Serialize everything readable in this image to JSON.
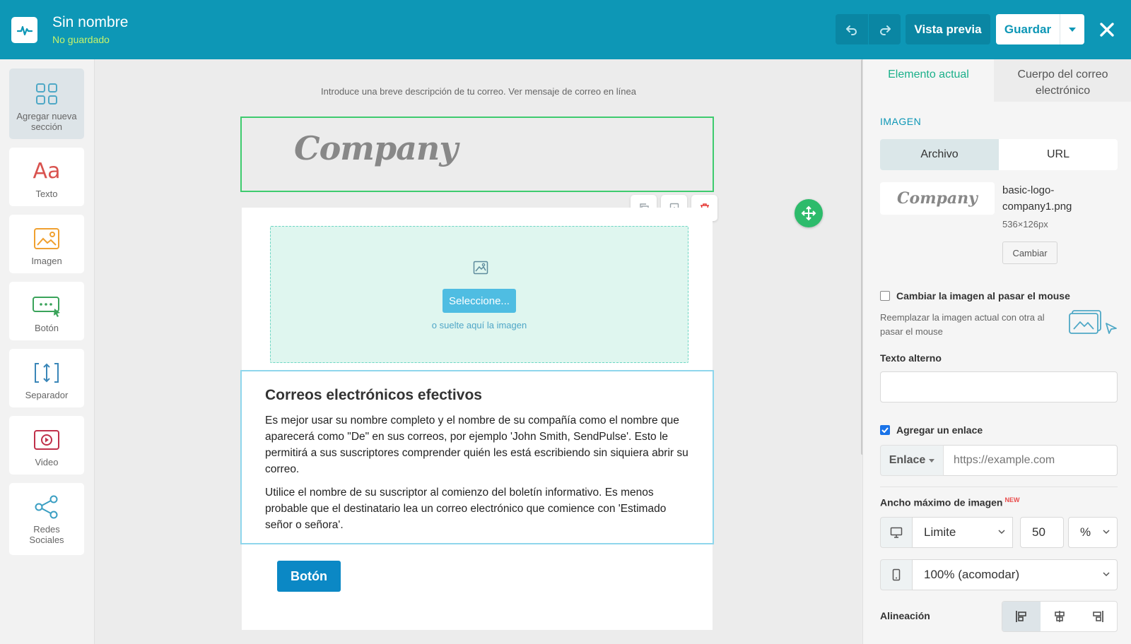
{
  "app": {
    "title": "Sin nombre",
    "status": "No guardado"
  },
  "toolbar": {
    "undo_icon": "undo-icon",
    "redo_icon": "redo-icon",
    "preview_label": "Vista previa",
    "save_label": "Guardar",
    "close_icon": "close-icon"
  },
  "sidebar": {
    "items": [
      {
        "label": "Agregar nueva sección",
        "icon": "grid-icon"
      },
      {
        "label": "Texto",
        "icon": "text-icon"
      },
      {
        "label": "Imagen",
        "icon": "image-icon"
      },
      {
        "label": "Botón",
        "icon": "button-icon"
      },
      {
        "label": "Separador",
        "icon": "separator-icon"
      },
      {
        "label": "Video",
        "icon": "video-icon"
      },
      {
        "label": "Redes Sociales",
        "icon": "share-icon"
      }
    ]
  },
  "canvas": {
    "preheader": "Introduce una breve descripción de tu correo. Ver mensaje de correo en línea",
    "logo_text": "Company",
    "dropzone_button": "Seleccione...",
    "dropzone_hint": "o suelte aquí la imagen",
    "heading": "Correos electrónicos efectivos",
    "paragraph1": "Es mejor usar su nombre completo y el nombre de su compañía como el nombre que aparecerá como \"De\" en sus correos, por ejemplo 'John Smith, SendPulse'. Esto le permitirá a sus suscriptores comprender quién les está escribiendo sin siquiera abrir su correo.",
    "paragraph2": "Utilice el nombre de su suscriptor al comienzo del boletín informativo. Es menos probable que el destinatario lea un correo electrónico que comience con 'Estimado señor o señora'.",
    "button_label": "Botón"
  },
  "panel": {
    "tabs": [
      {
        "label": "Elemento actual"
      },
      {
        "label": "Cuerpo del correo electrónico"
      }
    ],
    "section_title": "IMAGEN",
    "source_tabs": [
      "Archivo",
      "URL"
    ],
    "thumb_text": "Company",
    "file_name": "basic-logo-company1.png",
    "file_dims": "536×126px",
    "change_label": "Cambiar",
    "hover_label": "Cambiar la imagen al pasar el mouse",
    "hover_checked": false,
    "hover_desc": "Reemplazar la imagen actual con otra al pasar el mouse",
    "alt_label": "Texto alterno",
    "alt_value": "",
    "link_label": "Agregar un enlace",
    "link_checked": true,
    "link_type": "Enlace",
    "link_placeholder": "https://example.com",
    "maxwidth_label": "Ancho máximo de imagen",
    "new_badge": "NEW",
    "desktop_mode": "Limite",
    "desktop_value": "50",
    "desktop_unit": "%",
    "mobile_mode": "100% (acomodar)",
    "align_label": "Alineación"
  },
  "colors": {
    "brand": "#0d97b6",
    "accent_green": "#1bb08a",
    "save_text": "#0d97b6",
    "status_text": "#c6f36b",
    "button_blue": "#0b88c5"
  }
}
